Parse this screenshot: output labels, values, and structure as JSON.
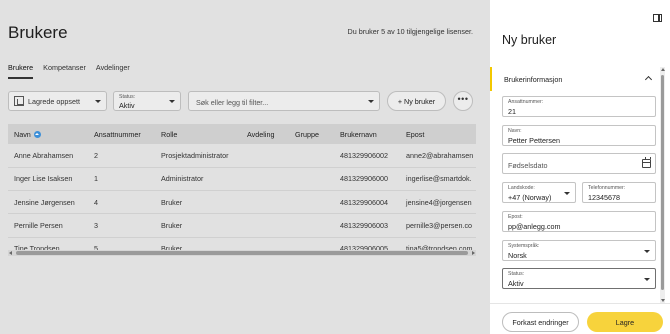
{
  "main": {
    "title": "Brukere",
    "license_text": "Du bruker 5 av 10 tilgjengelige lisenser.",
    "tabs": [
      {
        "label": "Brukere",
        "active": true
      },
      {
        "label": "Kompetanser",
        "active": false
      },
      {
        "label": "Avdelinger",
        "active": false
      }
    ],
    "toolbar": {
      "saved_setup_label": "Lagrede oppsett",
      "status_label": "Status:",
      "status_value": "Aktiv",
      "search_placeholder": "Søk eller legg til filter...",
      "new_user_label": "+ Ny bruker",
      "more_label": "•••"
    },
    "table": {
      "columns": [
        "Navn",
        "Ansattnummer",
        "Rolle",
        "Avdeling",
        "Gruppe",
        "Brukernavn",
        "Epost"
      ],
      "rows": [
        [
          "Anne Abrahamsen",
          "2",
          "Prosjektadministrator",
          "",
          "",
          "481329906002",
          "anne2@abrahamsen"
        ],
        [
          "Inger Lise Isaksen",
          "1",
          "Administrator",
          "",
          "",
          "481329906000",
          "ingerlise@smartdok."
        ],
        [
          "Jensine Jørgensen",
          "4",
          "Bruker",
          "",
          "",
          "481329906004",
          "jensine4@jorgensen"
        ],
        [
          "Pernille Persen",
          "3",
          "Bruker",
          "",
          "",
          "481329906003",
          "pernille3@persen.co"
        ],
        [
          "Tine Trondsen",
          "5",
          "Bruker",
          "",
          "",
          "481329906005",
          "tina5@trondsen.com"
        ]
      ]
    }
  },
  "panel": {
    "title": "Ny bruker",
    "section_title": "Brukerinformasjon",
    "fields": {
      "employee_number": {
        "label": "Ansattnummer:",
        "value": "21"
      },
      "name": {
        "label": "Navn:",
        "value": "Petter Pettersen"
      },
      "birth_date": {
        "placeholder": "Fødselsdato"
      },
      "country_code": {
        "label": "Landskode:",
        "value": "+47 (Norway)"
      },
      "phone": {
        "label": "Telefonnummer:",
        "value": "12345678"
      },
      "email": {
        "label": "Epost:",
        "value": "pp@anlegg.com"
      },
      "language": {
        "label": "Systemspråk:",
        "value": "Norsk"
      },
      "status": {
        "label": "Status:",
        "value": "Aktiv"
      }
    },
    "cancel_label": "Forkast endringer",
    "save_label": "Lagre"
  },
  "colors": {
    "accent": "#f7d33c",
    "section_marker": "#f3c800",
    "sort_icon": "#3c8fd8"
  }
}
